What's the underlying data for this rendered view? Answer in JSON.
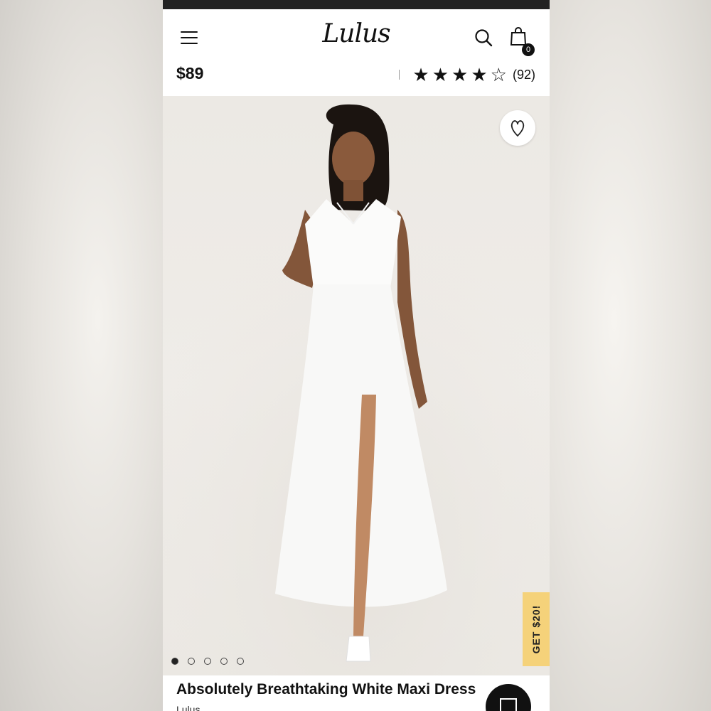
{
  "header": {
    "logo_text": "Lulus",
    "cart_count": "0"
  },
  "product": {
    "price": "$89",
    "rating_value": 4,
    "rating_max": 5,
    "review_count": "(92)",
    "title": "Absolutely Breathtaking White Maxi Dress",
    "brand": "Lulus"
  },
  "gallery": {
    "image_count": 5,
    "active_index": 0,
    "promo_tab_label": "GET $20!"
  },
  "colors": {
    "header_bg": "#ffffff",
    "promo_bg": "#f5d27a",
    "text": "#111111"
  },
  "icons": [
    "hamburger-menu-icon",
    "search-icon",
    "shopping-bag-icon",
    "heart-icon",
    "chat-icon",
    "star-icon"
  ]
}
